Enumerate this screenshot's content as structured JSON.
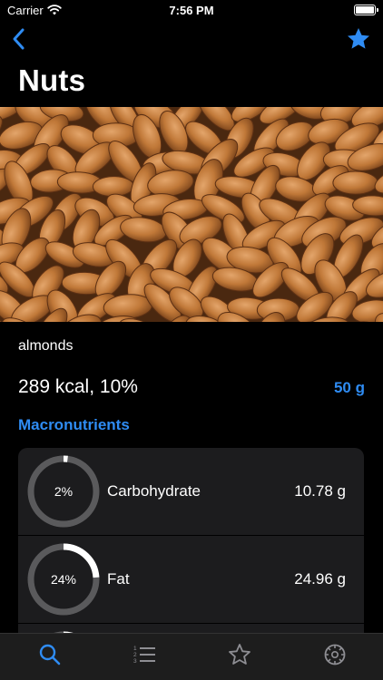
{
  "status": {
    "carrier": "Carrier",
    "time": "7:56 PM"
  },
  "nav": {
    "title": "Nuts",
    "back_icon": "chevron-left-icon",
    "favorite_icon": "star-filled-icon"
  },
  "hero": {
    "image": "almonds-photo"
  },
  "food": {
    "name": "almonds",
    "energy": "289 kcal, 10%",
    "portion": "50 g"
  },
  "macros": {
    "section_title": "Macronutrients",
    "items": [
      {
        "name": "Carbohydrate",
        "percent_label": "2%",
        "percent": 2,
        "value": "10.78 g"
      },
      {
        "name": "Fat",
        "percent_label": "24%",
        "percent": 24,
        "value": "24.96 g"
      },
      {
        "name": "",
        "percent_label": "",
        "percent": 15,
        "value": ""
      }
    ]
  },
  "tabbar": {
    "items": [
      {
        "icon": "search-icon",
        "active": true
      },
      {
        "icon": "list-icon",
        "active": false
      },
      {
        "icon": "star-outline-icon",
        "active": false
      },
      {
        "icon": "settings-gear-icon",
        "active": false
      }
    ]
  },
  "colors": {
    "accent": "#2f8cf3",
    "card": "#1c1c1e",
    "ring_track": "#5a5a5c",
    "ring_fill": "#ffffff"
  }
}
